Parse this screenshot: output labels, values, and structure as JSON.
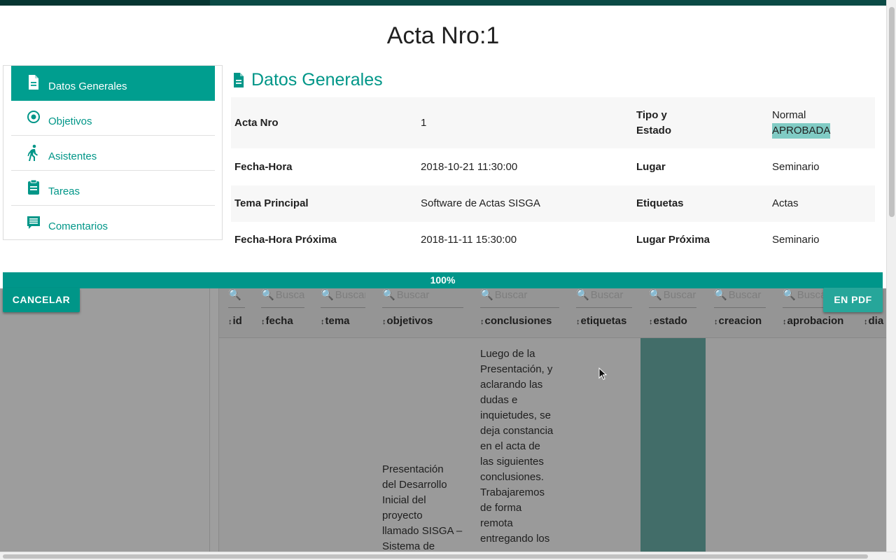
{
  "modal": {
    "title": "Acta Nro:1",
    "nav": [
      {
        "label": "Datos Generales",
        "icon": "document-icon",
        "active": true
      },
      {
        "label": "Objetivos",
        "icon": "target-icon"
      },
      {
        "label": "Asistentes",
        "icon": "walking-person-icon"
      },
      {
        "label": "Tareas",
        "icon": "clipboard-icon"
      },
      {
        "label": "Comentarios",
        "icon": "comment-icon"
      }
    ],
    "section_title": "Datos Generales",
    "info_rows": [
      {
        "k1": "Acta Nro",
        "v1": "1",
        "k2a": "Tipo y",
        "k2b": "Estado",
        "v2a": "Normal",
        "v2b": "APROBADA"
      },
      {
        "k1": "Fecha-Hora",
        "v1": "2018-10-21 11:30:00",
        "k2": "Lugar",
        "v2": "Seminario"
      },
      {
        "k1": "Tema Principal",
        "v1": "Software de Actas SISGA",
        "k2": "Etiquetas",
        "v2": "Actas"
      },
      {
        "k1": "Fecha-Hora Próxima",
        "v1": "2018-11-11 15:30:00",
        "k2": "Lugar Próxima",
        "v2": "Seminario"
      }
    ],
    "progress": "100%",
    "colors": {
      "accent": "#009688",
      "highlight": "#80cbc4"
    }
  },
  "actions": {
    "cancel_label": "CANCELAR",
    "pdf_label": "EN PDF"
  },
  "background_table": {
    "search_placeholder": "Buscar",
    "columns": [
      "id",
      "fecha",
      "tema",
      "objetivos",
      "conclusiones",
      "etiquetas",
      "estado",
      "creacion",
      "aprobacion",
      "dia"
    ],
    "row": {
      "objetivos": [
        "Presentación",
        "del Desarrollo",
        "Inicial del",
        "proyecto",
        "llamado SISGA –",
        "Sistema de"
      ],
      "conclusiones": [
        "Luego de la",
        "Presentación, y",
        "aclarando las",
        "dudas e",
        "inquietudes, se",
        "deja constancia",
        "en el acta de",
        "las siguientes",
        "conclusiones.",
        "Trabajaremos",
        "de forma",
        "remota",
        "entregando los"
      ]
    }
  }
}
